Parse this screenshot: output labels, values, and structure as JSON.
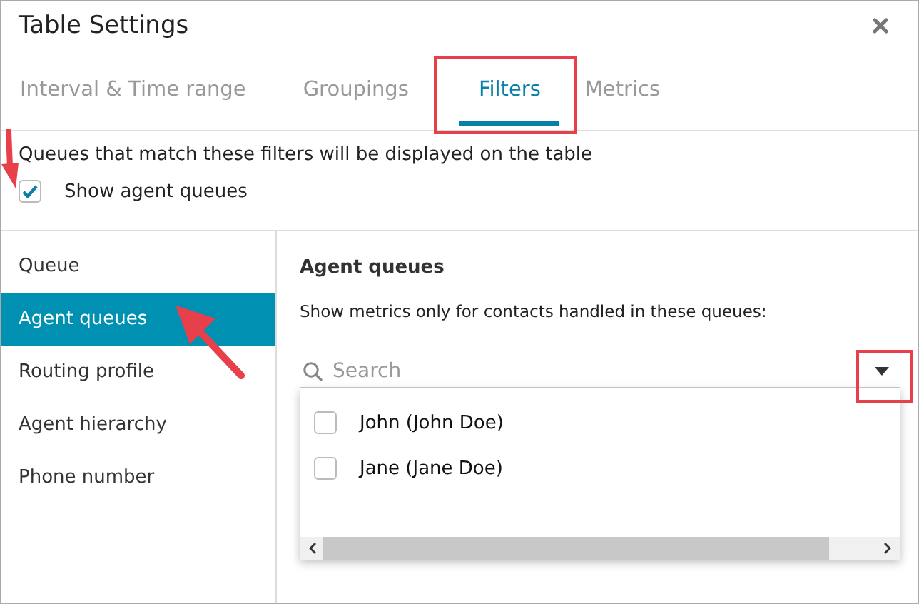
{
  "window": {
    "title": "Table Settings"
  },
  "tabs": [
    {
      "label": "Interval & Time range",
      "selected": false
    },
    {
      "label": "Groupings",
      "selected": false
    },
    {
      "label": "Filters",
      "selected": true
    },
    {
      "label": "Metrics",
      "selected": false
    }
  ],
  "description": "Queues that match these filters will be displayed on the table",
  "show_agent_queues": {
    "label": "Show agent queues",
    "checked": true
  },
  "sidebar": {
    "items": [
      {
        "label": "Queue",
        "selected": false
      },
      {
        "label": "Agent queues",
        "selected": true
      },
      {
        "label": "Routing profile",
        "selected": false
      },
      {
        "label": "Agent hierarchy",
        "selected": false
      },
      {
        "label": "Phone number",
        "selected": false
      }
    ]
  },
  "panel": {
    "heading": "Agent queues",
    "hint": "Show metrics only for contacts handled in these queues:",
    "search": {
      "placeholder": "Search"
    },
    "options": [
      {
        "label": "John (John Doe)",
        "checked": false
      },
      {
        "label": "Jane (Jane Doe)",
        "checked": false
      }
    ]
  }
}
